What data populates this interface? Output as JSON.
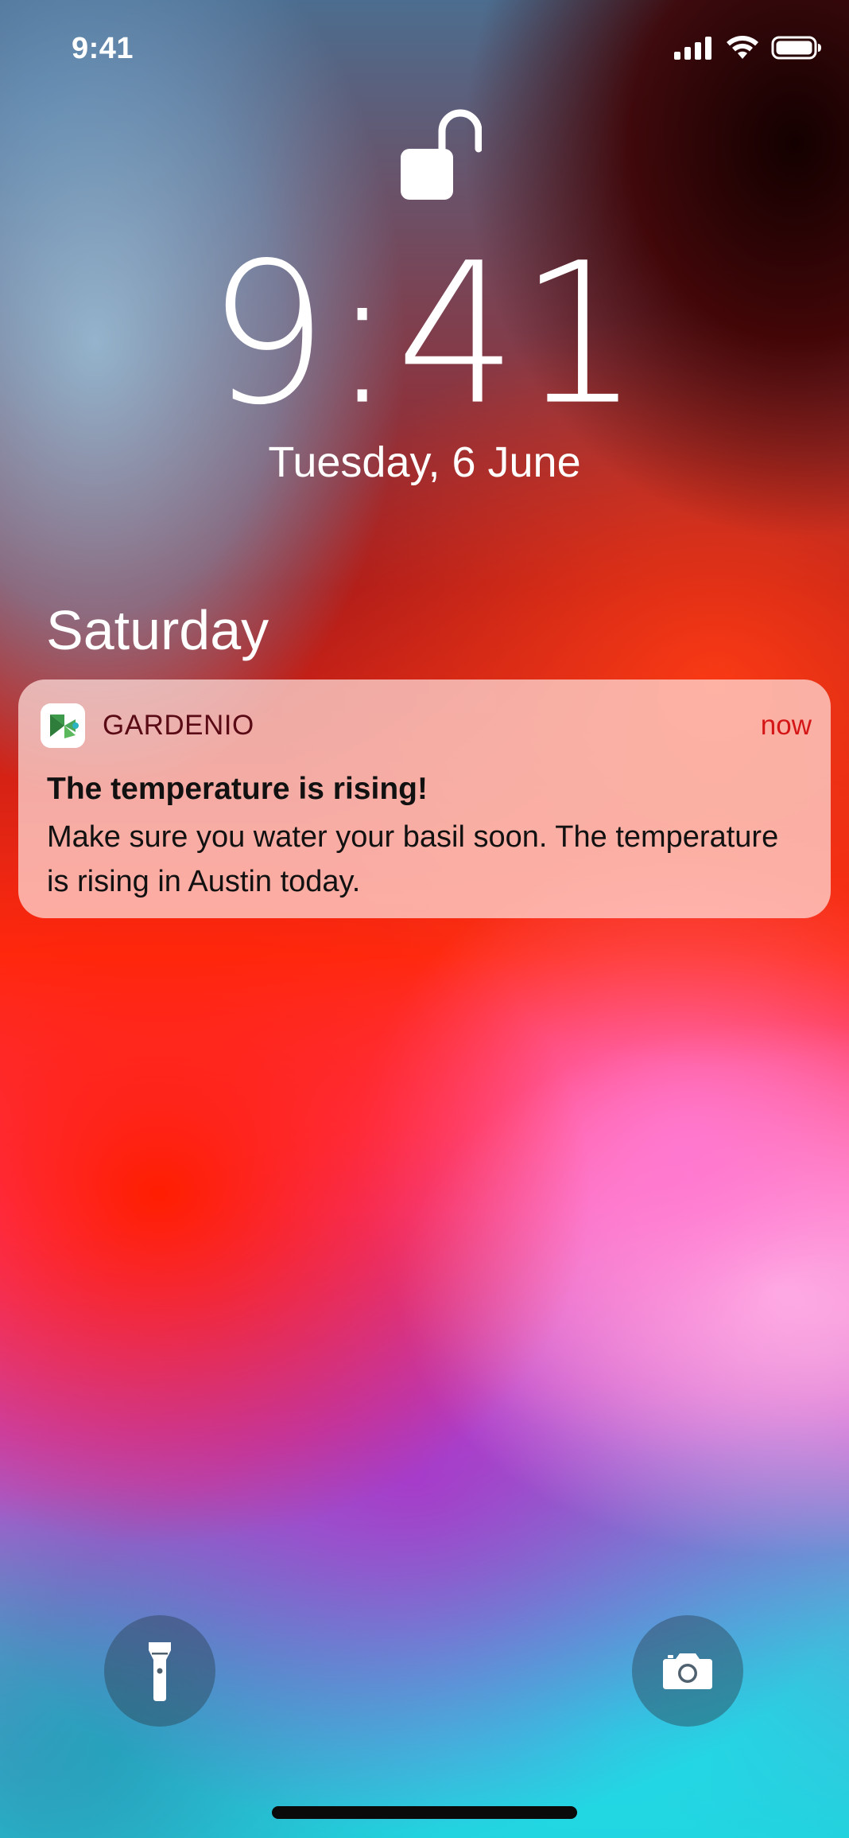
{
  "status_bar": {
    "time": "9:41",
    "icons": [
      "cellular-signal-icon",
      "wifi-icon",
      "battery-icon"
    ]
  },
  "lock_screen": {
    "lock_icon": "unlocked-padlock-icon",
    "time": "9:41",
    "date": "Tuesday, 6 June"
  },
  "notifications": {
    "section_title": "Saturday",
    "items": [
      {
        "app_name": "GARDENIO",
        "app_icon": "gardenio-leaf-icon",
        "time": "now",
        "title": "The temperature is rising!",
        "body": "Make sure you water your basil soon. The temperature is rising in Austin today."
      }
    ]
  },
  "quick_actions": {
    "left": "flashlight-icon",
    "right": "camera-icon"
  },
  "colors": {
    "notification_time": "#d51616",
    "app_name": "#5a0a14",
    "home_indicator": "#0a0a0a"
  }
}
